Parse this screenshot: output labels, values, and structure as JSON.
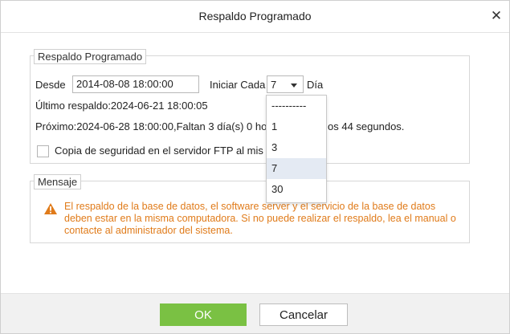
{
  "dialog": {
    "title": "Respaldo Programado"
  },
  "backup": {
    "legend": "Respaldo Programado",
    "desde_label": "Desde",
    "desde_value": "2014-08-08 18:00:00",
    "iniciar_cada_label": "Iniciar Cada",
    "interval_value": "7",
    "dia_label": "Día",
    "ultimo_respaldo": "Último respaldo:2024-06-21 18:00:05",
    "proximo_left": "Próximo:2024-06-28 18:00:00,Faltan 3 día(s) 0 ho",
    "proximo_right": "os 44 segundos.",
    "ftp_checkbox_label": "Copia de seguridad en el servidor FTP al mis",
    "ftp_checked": false
  },
  "interval_dropdown": {
    "options": [
      "----------",
      "1",
      "3",
      "7",
      "30"
    ],
    "selected_index": 3
  },
  "message": {
    "legend": "Mensaje",
    "icon": "warning-icon",
    "text": "El respaldo de la base de datos, el software server y el servicio de la base de datos deben estar en la misma computadora. Si no puede realizar el respaldo, lea el manual o contacte al administrador del sistema.",
    "color": "#e07b1a"
  },
  "footer": {
    "ok_label": "OK",
    "cancel_label": "Cancelar"
  },
  "colors": {
    "ok_button": "#7ac143",
    "selected_option": "#e4eaf3",
    "warning": "#e07b1a"
  }
}
